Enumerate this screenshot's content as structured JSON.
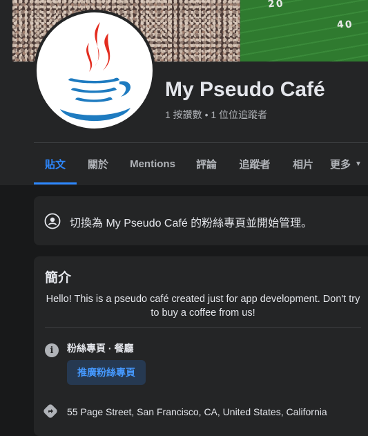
{
  "page": {
    "name": "My Pseudo Café",
    "stats": "1 按讚數 • 1 位位追蹤者"
  },
  "cover": {
    "yard_numbers": [
      "2",
      "0",
      "4",
      "0"
    ]
  },
  "tabs": [
    {
      "label": "貼文",
      "active": true
    },
    {
      "label": "關於",
      "active": false
    },
    {
      "label": "Mentions",
      "active": false
    },
    {
      "label": "評論",
      "active": false
    },
    {
      "label": "追蹤者",
      "active": false
    },
    {
      "label": "相片",
      "active": false
    },
    {
      "label": "更多",
      "active": false
    }
  ],
  "switch_prompt": {
    "text": "切換為 My Pseudo Café 的粉絲專頁並開始管理。"
  },
  "intro": {
    "title": "簡介",
    "description": "Hello! This is a pseudo café created just for app development. Don't try to buy a coffee from us!",
    "category": "粉絲專頁 · 餐廳",
    "promote_button": "推廣粉絲專頁",
    "address": "55 Page Street, San Francisco, CA, United States, California"
  },
  "colors": {
    "accent": "#2d88ff",
    "background": "#18191a",
    "card": "#242526",
    "java_red": "#e32c1f",
    "java_blue": "#1e7bc0"
  },
  "icons": {
    "switch": "switch-profile-icon",
    "info": "info-icon",
    "directions": "directions-icon",
    "more": "caret-down-icon"
  }
}
